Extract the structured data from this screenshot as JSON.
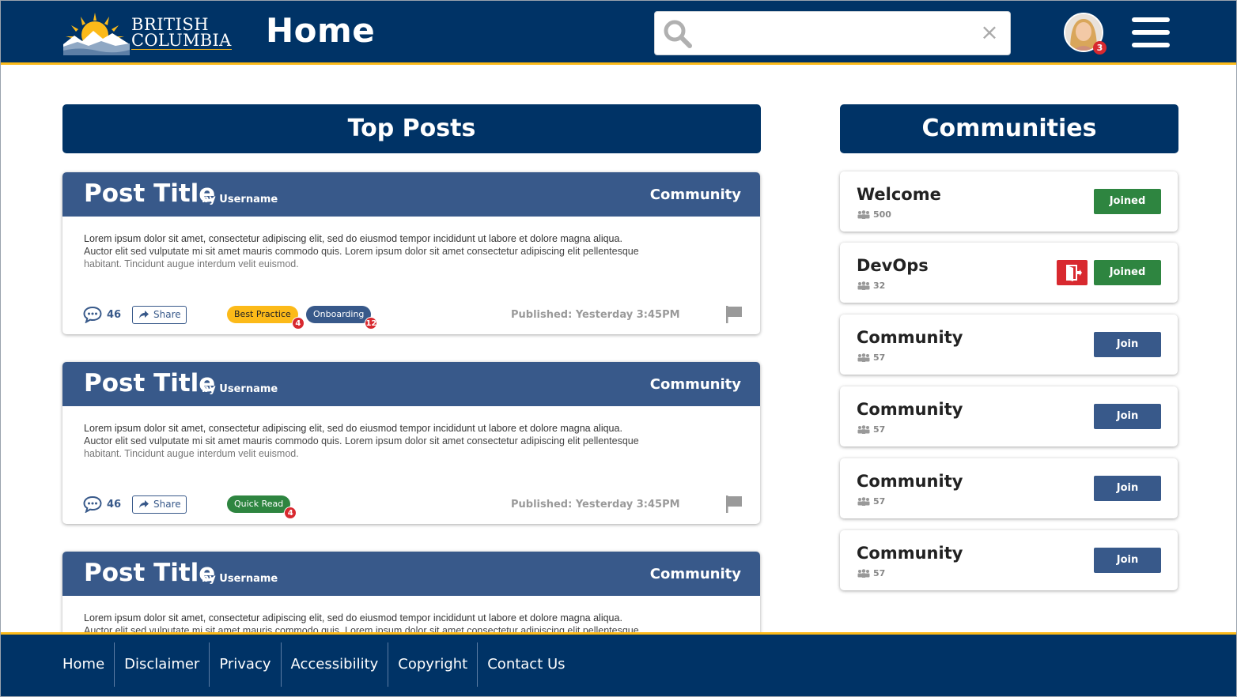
{
  "header": {
    "logo": {
      "line1": "British",
      "line2": "Columbia"
    },
    "title": "Home",
    "search": {
      "placeholder": "",
      "clear_icon": "close-icon"
    },
    "notification_count": "3",
    "menu_icon": "hamburger-menu-icon"
  },
  "top_posts": {
    "heading": "Top Posts",
    "posts": [
      {
        "title": "Post Title",
        "author": "by Username",
        "community": "Community",
        "body": [
          "Lorem ipsum dolor sit amet, consectetur adipiscing elit, sed do eiusmod tempor incididunt ut labore et dolore magna aliqua.",
          "Auctor elit sed vulputate mi sit amet mauris commodo quis. Lorem ipsum dolor sit amet consectetur adipiscing elit pellentesque",
          "habitant. Tincidunt augue interdum velit euismod."
        ],
        "comments": "46",
        "share_label": "Share",
        "tags": [
          {
            "label": "Best Practice",
            "count": "4",
            "color": "#fcba19",
            "text_color": "#222222"
          },
          {
            "label": "Onboarding",
            "count": "12",
            "color": "#38598a",
            "text_color": "#ffffff"
          }
        ],
        "published": "Published: Yesterday 3:45PM"
      },
      {
        "title": "Post Title",
        "author": "by Username",
        "community": "Community",
        "body": [
          "Lorem ipsum dolor sit amet, consectetur adipiscing elit, sed do eiusmod tempor incididunt ut labore et dolore magna aliqua.",
          "Auctor elit sed vulputate mi sit amet mauris commodo quis. Lorem ipsum dolor sit amet consectetur adipiscing elit pellentesque",
          "habitant. Tincidunt augue interdum velit euismod."
        ],
        "comments": "46",
        "share_label": "Share",
        "tags": [
          {
            "label": "Quick Read",
            "count": "4",
            "color": "#2e8540",
            "text_color": "#ffffff"
          }
        ],
        "published": "Published: Yesterday 3:45PM"
      },
      {
        "title": "Post Title",
        "author": "by Username",
        "community": "Community",
        "body": [
          "Lorem ipsum dolor sit amet, consectetur adipiscing elit, sed do eiusmod tempor incididunt ut labore et dolore magna aliqua.",
          "Auctor elit sed vulputate mi sit amet mauris commodo quis. Lorem ipsum dolor sit amet consectetur adipiscing elit pellentesque",
          ""
        ],
        "comments": "",
        "share_label": "",
        "tags": [],
        "published": ""
      }
    ]
  },
  "communities": {
    "heading": "Communities",
    "items": [
      {
        "name": "Welcome",
        "members": "500",
        "action": "Joined",
        "can_leave": false
      },
      {
        "name": "DevOps",
        "members": "32",
        "action": "Joined",
        "can_leave": true
      },
      {
        "name": "Community",
        "members": "57",
        "action": "Join",
        "can_leave": false
      },
      {
        "name": "Community",
        "members": "57",
        "action": "Join",
        "can_leave": false
      },
      {
        "name": "Community",
        "members": "57",
        "action": "Join",
        "can_leave": false
      },
      {
        "name": "Community",
        "members": "57",
        "action": "Join",
        "can_leave": false
      }
    ]
  },
  "footer": {
    "links": [
      "Home",
      "Disclaimer",
      "Privacy",
      "Accessibility",
      "Copyright",
      "Contact Us"
    ]
  },
  "colors": {
    "primary": "#003366",
    "accent": "#fcba19",
    "post_header": "#38598a",
    "joined": "#2e8540",
    "alert": "#d8292f"
  }
}
